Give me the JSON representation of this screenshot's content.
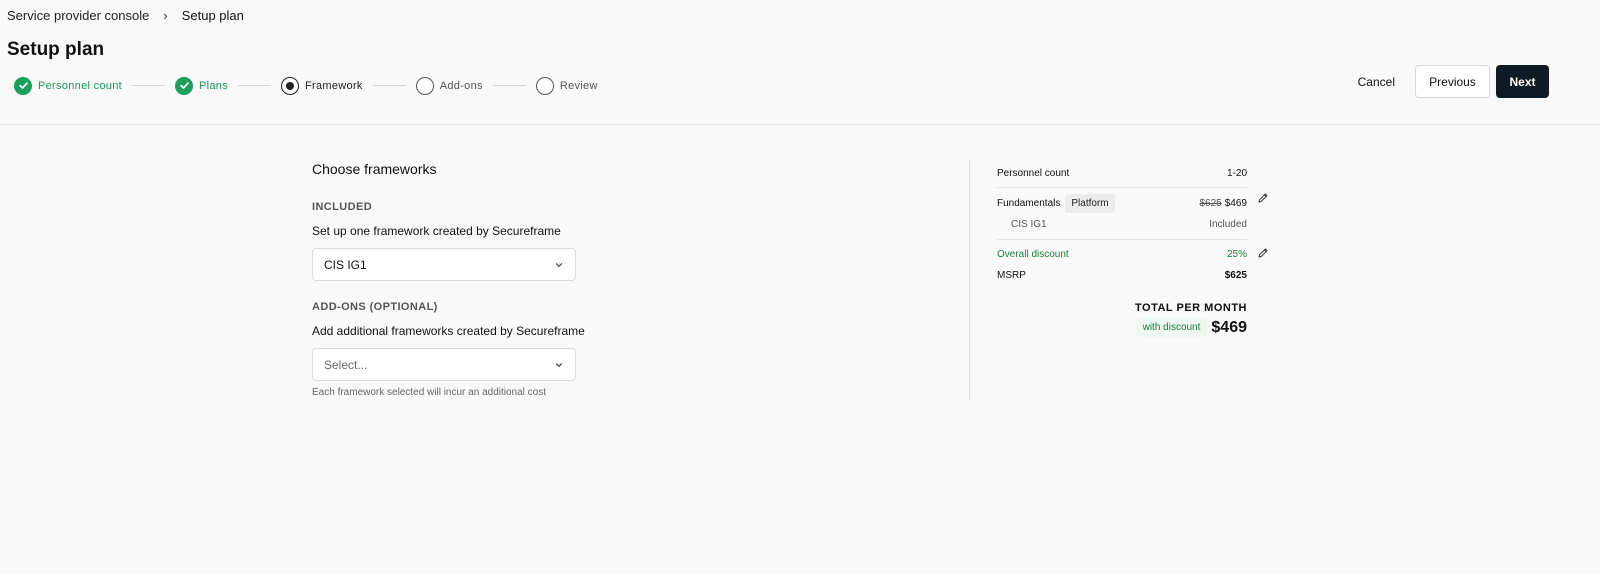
{
  "breadcrumb": {
    "parent": "Service provider console",
    "separator": "›",
    "current": "Setup plan"
  },
  "page": {
    "title": "Setup plan"
  },
  "stepper": {
    "steps": [
      {
        "label": "Personnel count",
        "state": "done"
      },
      {
        "label": "Plans",
        "state": "done"
      },
      {
        "label": "Framework",
        "state": "active"
      },
      {
        "label": "Add-ons",
        "state": "todo"
      },
      {
        "label": "Review",
        "state": "todo"
      }
    ]
  },
  "actions": {
    "cancel": "Cancel",
    "previous": "Previous",
    "next": "Next"
  },
  "main": {
    "title": "Choose frameworks",
    "included": {
      "group_label": "INCLUDED",
      "field_label": "Set up one framework created by Secureframe",
      "selected": "CIS IG1"
    },
    "addons": {
      "group_label": "ADD-ONS (OPTIONAL)",
      "field_label": "Add additional frameworks created by Secureframe",
      "placeholder": "Select...",
      "hint": "Each framework selected will incur an additional cost"
    }
  },
  "summary": {
    "personnel_label": "Personnel count",
    "personnel_value": "1-20",
    "plan_label": "Fundamentals",
    "plan_tag": "Platform",
    "plan_old_price": "$625",
    "plan_price": "$469",
    "framework_label": "CIS IG1",
    "framework_value": "Included",
    "discount_label": "Overall discount",
    "discount_value": "25%",
    "msrp_label": "MSRP",
    "msrp_value": "$625",
    "total_label": "TOTAL PER MONTH",
    "total_badge": "with discount",
    "total_amount": "$469"
  },
  "colors": {
    "accent_green": "#1aa05a",
    "primary_button": "#0f1a24"
  }
}
